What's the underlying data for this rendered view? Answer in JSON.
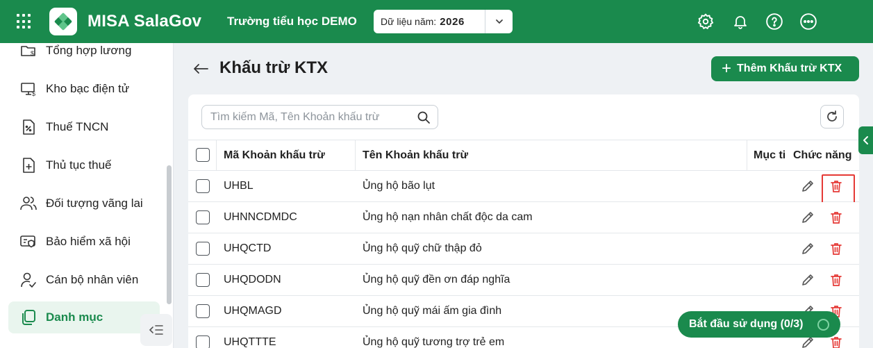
{
  "header": {
    "brand": "MISA SalaGov",
    "school": "Trường tiểu học DEMO",
    "year_label": "Dữ liệu năm:",
    "year_value": "2026",
    "brand_color": "#1a8a4d"
  },
  "sidebar": {
    "items": [
      {
        "label": "Tổng hợp lương",
        "icon": "folder-dollar-icon"
      },
      {
        "label": "Kho bạc điện tử",
        "icon": "monitor-dollar-icon"
      },
      {
        "label": "Thuế TNCN",
        "icon": "percent-document-icon"
      },
      {
        "label": "Thủ tục thuế",
        "icon": "document-plus-icon"
      },
      {
        "label": "Đối tượng vãng lai",
        "icon": "users-icon"
      },
      {
        "label": "Bảo hiểm xã hội",
        "icon": "shield-card-icon"
      },
      {
        "label": "Cán bộ nhân viên",
        "icon": "user-check-icon"
      },
      {
        "label": "Danh mục",
        "icon": "copy-icon",
        "active": true
      }
    ]
  },
  "page": {
    "title": "Khấu trừ KTX",
    "add_button": "Thêm Khấu trừ KTX"
  },
  "search": {
    "placeholder": "Tìm kiếm Mã, Tên Khoản khấu trừ"
  },
  "table": {
    "columns": [
      "Mã Khoản khấu trừ",
      "Tên Khoản khấu trừ",
      "Mục ti",
      "Chức năng"
    ],
    "rows": [
      {
        "code": "UHBL",
        "name": "Ủng hộ bão lụt"
      },
      {
        "code": "UHNNCDMDC",
        "name": "Ủng hộ nạn nhân chất độc da cam"
      },
      {
        "code": "UHQCTD",
        "name": "Ủng hộ quỹ chữ thập đỏ"
      },
      {
        "code": "UHQDODN",
        "name": "Ủng hộ quỹ đền ơn đáp nghĩa"
      },
      {
        "code": "UHQMAGD",
        "name": "Ủng hộ quỹ mái ấm gia đình"
      },
      {
        "code": "UHQTTTE",
        "name": "Ủng hộ quỹ tương trợ trẻ em"
      }
    ]
  },
  "onboarding": {
    "label": "Bắt đầu sử dụng (0/3)"
  },
  "colors": {
    "accent": "#1a8a4d",
    "danger": "#e53935"
  }
}
